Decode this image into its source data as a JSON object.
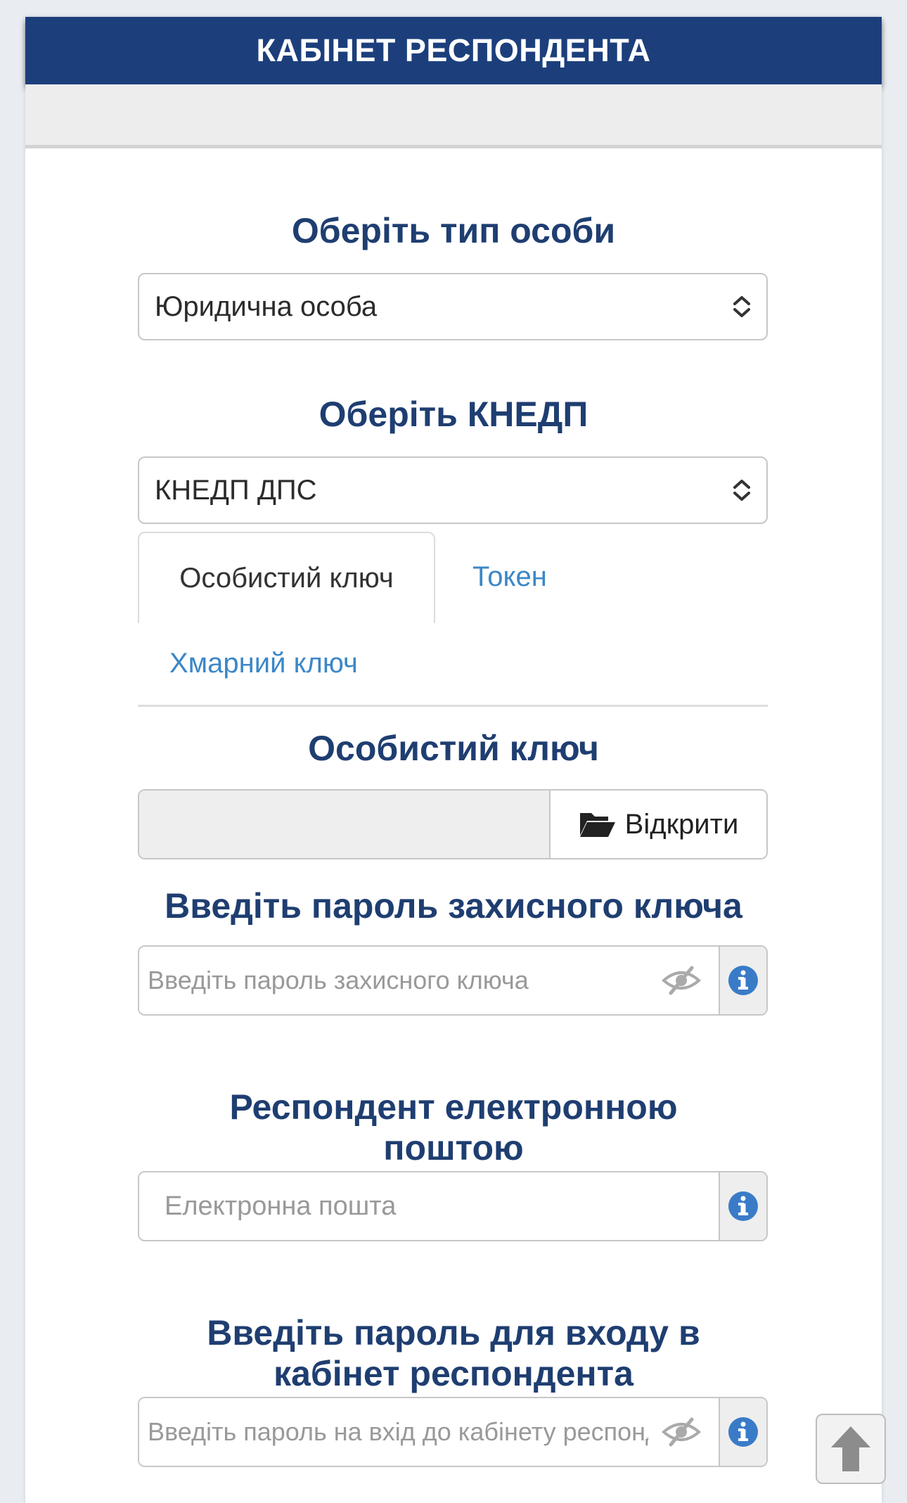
{
  "header": {
    "title": "КАБІНЕТ РЕСПОНДЕНТА"
  },
  "person_type": {
    "title": "Оберіть тип особи",
    "selected": "Юридична особа"
  },
  "kep": {
    "title": "Оберіть КНЕДП",
    "selected": "КНЕДП ДПС"
  },
  "tabs": [
    {
      "label": "Особистий ключ",
      "active": true
    },
    {
      "label": "Токен",
      "active": false
    },
    {
      "label": "Хмарний ключ",
      "active": false
    }
  ],
  "key_file": {
    "title": "Особистий ключ",
    "open_label": "Відкрити",
    "open_icon": "folder-open-icon"
  },
  "key_password": {
    "title": "Введіть пароль захисного ключа",
    "placeholder": "Введіть пароль захисного ключа"
  },
  "email": {
    "title_line1": "Респондент електронною",
    "title_line2": "поштою",
    "placeholder": "Електронна пошта"
  },
  "cabinet_password": {
    "title_line1": "Введіть пароль для входу в",
    "title_line2": "кабінет респондента",
    "placeholder": "Введіть пароль на вхід до кабінету респондента"
  },
  "colors": {
    "header_bg": "#1c3f7c",
    "title_text": "#1f3e71",
    "link": "#3c87c7",
    "info_icon": "#3a7bc8"
  }
}
